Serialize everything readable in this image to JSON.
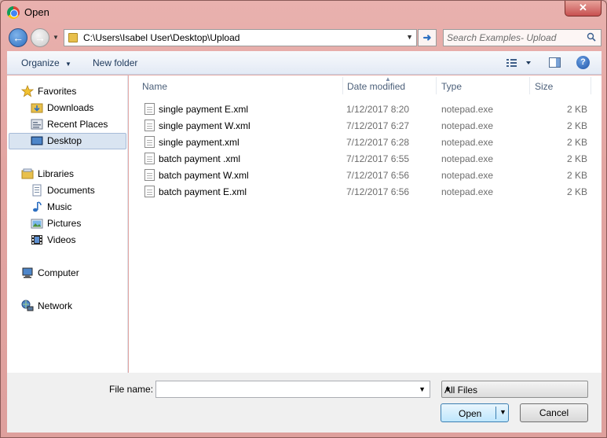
{
  "window": {
    "title": "Open",
    "close_label": "✕"
  },
  "nav": {
    "address": "C:\\Users\\Isabel User\\Desktop\\Upload",
    "search_placeholder": "Search Examples- Upload"
  },
  "toolbar": {
    "organize_label": "Organize",
    "new_folder_label": "New folder",
    "help_label": "?"
  },
  "sidebar": {
    "groups": [
      {
        "label": "Favorites",
        "icon": "star-icon"
      },
      {
        "label": "Downloads",
        "icon": "downloads-folder-icon"
      },
      {
        "label": "Recent Places",
        "icon": "recent-places-icon"
      },
      {
        "label": "Desktop",
        "icon": "desktop-icon",
        "selected": true
      },
      {
        "label": "Libraries",
        "icon": "libraries-icon"
      },
      {
        "label": "Documents",
        "icon": "documents-icon"
      },
      {
        "label": "Music",
        "icon": "music-icon"
      },
      {
        "label": "Pictures",
        "icon": "pictures-icon"
      },
      {
        "label": "Videos",
        "icon": "videos-icon"
      },
      {
        "label": "Computer",
        "icon": "computer-icon"
      },
      {
        "label": "Network",
        "icon": "network-icon"
      }
    ]
  },
  "file_list": {
    "columns": [
      "Name",
      "Date modified",
      "Type",
      "Size"
    ],
    "rows": [
      {
        "name": "single payment E.xml",
        "date": "1/12/2017 8:20",
        "type": "notepad.exe",
        "size": "2 KB"
      },
      {
        "name": "single payment W.xml",
        "date": "7/12/2017 6:27",
        "type": "notepad.exe",
        "size": "2 KB"
      },
      {
        "name": "single payment.xml",
        "date": "7/12/2017 6:28",
        "type": "notepad.exe",
        "size": "2 KB"
      },
      {
        "name": "batch payment .xml",
        "date": "7/12/2017 6:55",
        "type": "notepad.exe",
        "size": "2 KB"
      },
      {
        "name": "batch payment W.xml",
        "date": "7/12/2017 6:56",
        "type": "notepad.exe",
        "size": "2 KB"
      },
      {
        "name": "batch payment E.xml",
        "date": "7/12/2017 6:56",
        "type": "notepad.exe",
        "size": "2 KB"
      }
    ]
  },
  "bottom": {
    "file_name_label": "File name:",
    "file_name_value": "",
    "file_type_value": "All Files",
    "open_label": "Open",
    "cancel_label": "Cancel"
  },
  "colors": {
    "frame": "#e2a4a1",
    "toolbar": "#e3eaf5",
    "accent_blue": "#2d6fc0",
    "selection": "#d9e4f1"
  }
}
